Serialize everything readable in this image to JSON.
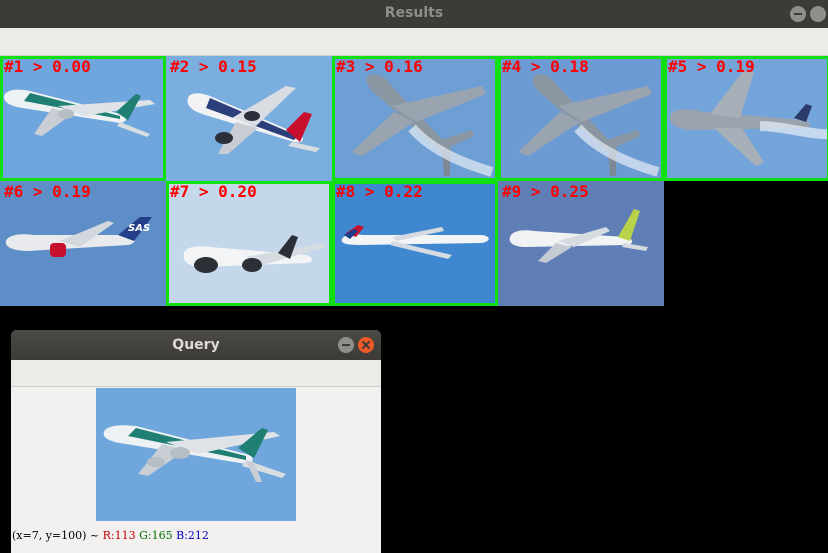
{
  "results_window": {
    "title": "Results"
  },
  "results": [
    {
      "label": "#1 > 0.00",
      "highlighted": true,
      "sky": "#6fa6de",
      "scene": "cathay-left"
    },
    {
      "label": "#2 > 0.15",
      "highlighted": false,
      "sky": "#79aedf",
      "scene": "ba-climb"
    },
    {
      "label": "#3 > 0.16",
      "highlighted": true,
      "sky": "#6d9fd4",
      "scene": "underside-dive"
    },
    {
      "label": "#4 > 0.18",
      "highlighted": true,
      "sky": "#6b9bd2",
      "scene": "underside-dive"
    },
    {
      "label": "#5 > 0.19",
      "highlighted": true,
      "sky": "#74a5da",
      "scene": "underside-left"
    },
    {
      "label": "#6 > 0.19",
      "highlighted": false,
      "sky": "#5d8ec7",
      "scene": "sas"
    },
    {
      "label": "#7 > 0.20",
      "highlighted": true,
      "sky": "#c5d7ea",
      "scene": "trijet-right"
    },
    {
      "label": "#8 > 0.22",
      "highlighted": true,
      "sky": "#3f88d0",
      "scene": "long-right"
    },
    {
      "label": "#9 > 0.25",
      "highlighted": false,
      "sky": "#5f7eb5",
      "scene": "airbaltic"
    }
  ],
  "query_window": {
    "title": "Query",
    "status": {
      "coords": "(x=7, y=100) ~",
      "r": "R:113",
      "g": "G:165",
      "b": "B:212"
    }
  },
  "colors": {
    "highlight_border": "#10e010",
    "label_text": "#ff0000",
    "titlebar": "#3c3b37",
    "close_button": "#f05a28"
  }
}
